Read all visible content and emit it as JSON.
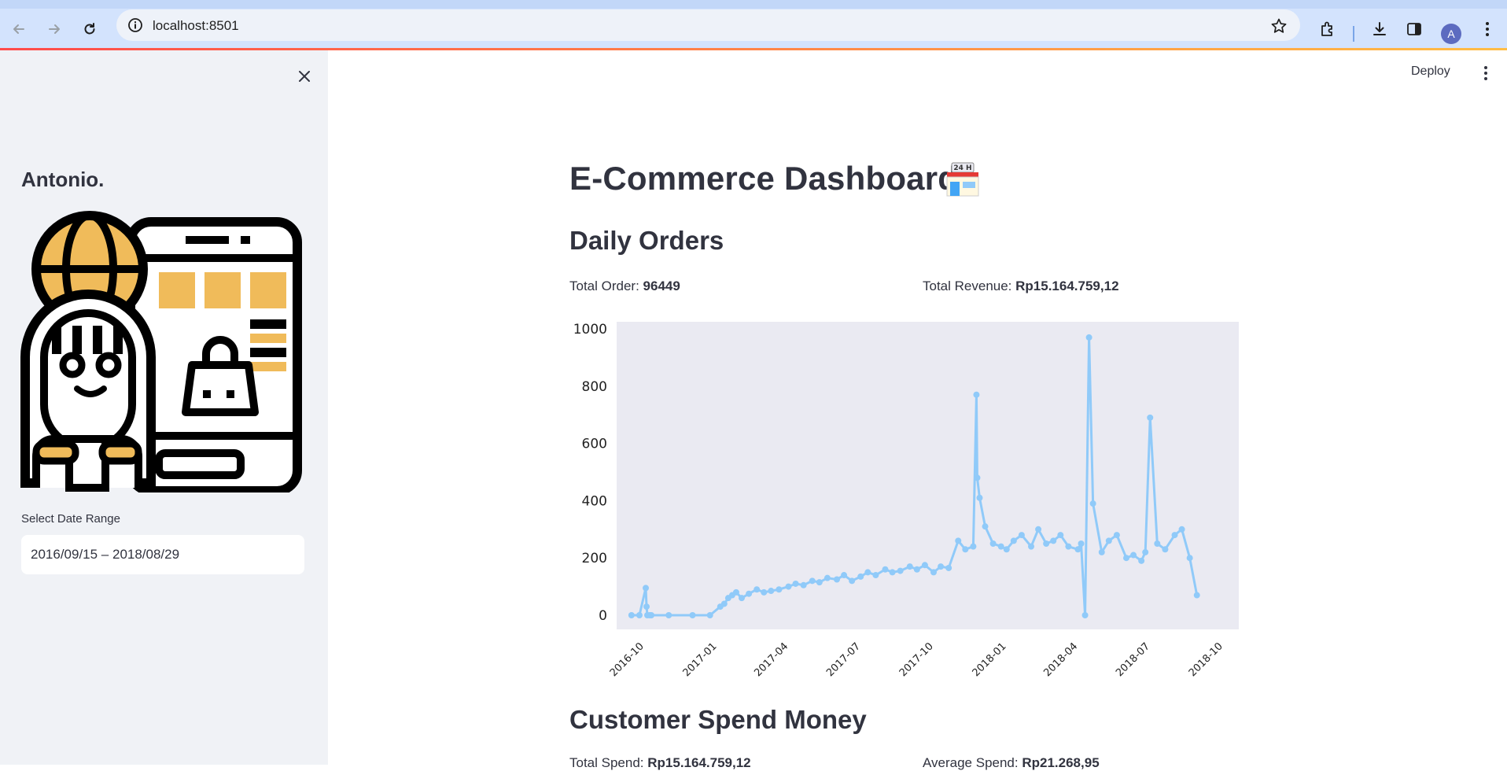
{
  "browser": {
    "url": "localhost:8501",
    "avatar_letter": "A"
  },
  "app": {
    "deploy_label": "Deploy"
  },
  "sidebar": {
    "brand": "Antonio.",
    "date_label": "Select Date Range",
    "date_value": "2016/09/15 – 2018/08/29"
  },
  "main": {
    "title": "E-Commerce Dashboard",
    "daily_orders_heading": "Daily Orders",
    "total_order_label": "Total Order:",
    "total_order_value": "96449",
    "total_revenue_label": "Total Revenue:",
    "total_revenue_value": "Rp15.164.759,12",
    "customer_spend_heading": "Customer Spend Money",
    "total_spend_label": "Total Spend:",
    "total_spend_value": "Rp15.164.759,12",
    "average_spend_label": "Average Spend:",
    "average_spend_value": "Rp21.268,95"
  },
  "colors": {
    "line": "#90caf9",
    "plot_bg": "#eaeaf2",
    "sidebar_bg": "#f0f2f6",
    "accent_yellow": "#f0bb5a"
  },
  "chart_data": {
    "type": "line",
    "title": "",
    "xlabel": "",
    "ylabel": "",
    "ylim": [
      0,
      1000
    ],
    "yticks": [
      0,
      200,
      400,
      600,
      800,
      1000
    ],
    "xticks": [
      "2016-10",
      "2017-01",
      "2017-04",
      "2017-07",
      "2017-10",
      "2018-01",
      "2018-04",
      "2018-07",
      "2018-10"
    ],
    "x": [
      "2016-09-15",
      "2016-09-25",
      "2016-10-03",
      "2016-10-04",
      "2016-10-05",
      "2016-10-08",
      "2016-10-10",
      "2016-11-01",
      "2016-12-01",
      "2016-12-23",
      "2017-01-05",
      "2017-01-10",
      "2017-01-15",
      "2017-01-20",
      "2017-01-25",
      "2017-02-01",
      "2017-02-10",
      "2017-02-20",
      "2017-03-01",
      "2017-03-10",
      "2017-03-20",
      "2017-04-01",
      "2017-04-10",
      "2017-04-20",
      "2017-05-01",
      "2017-05-10",
      "2017-05-20",
      "2017-06-01",
      "2017-06-10",
      "2017-06-20",
      "2017-07-01",
      "2017-07-10",
      "2017-07-20",
      "2017-08-01",
      "2017-08-10",
      "2017-08-20",
      "2017-09-01",
      "2017-09-10",
      "2017-09-20",
      "2017-10-01",
      "2017-10-10",
      "2017-10-20",
      "2017-11-01",
      "2017-11-10",
      "2017-11-20",
      "2017-11-24",
      "2017-11-25",
      "2017-11-28",
      "2017-12-05",
      "2017-12-15",
      "2017-12-25",
      "2018-01-01",
      "2018-01-10",
      "2018-01-20",
      "2018-02-01",
      "2018-02-10",
      "2018-02-20",
      "2018-03-01",
      "2018-03-10",
      "2018-03-20",
      "2018-04-01",
      "2018-04-05",
      "2018-04-10",
      "2018-04-15",
      "2018-04-20",
      "2018-05-01",
      "2018-05-10",
      "2018-05-20",
      "2018-06-01",
      "2018-06-10",
      "2018-06-20",
      "2018-06-25",
      "2018-07-01",
      "2018-07-10",
      "2018-07-20",
      "2018-08-01",
      "2018-08-10",
      "2018-08-20",
      "2018-08-29"
    ],
    "series": [
      {
        "values": [
          0,
          0,
          95,
          30,
          0,
          0,
          0,
          0,
          0,
          0,
          30,
          40,
          60,
          70,
          80,
          60,
          75,
          90,
          80,
          85,
          90,
          100,
          110,
          105,
          120,
          115,
          130,
          125,
          140,
          120,
          135,
          150,
          140,
          160,
          150,
          155,
          170,
          160,
          175,
          150,
          170,
          165,
          260,
          230,
          240,
          770,
          480,
          410,
          310,
          250,
          240,
          230,
          260,
          280,
          240,
          300,
          250,
          260,
          280,
          240,
          230,
          250,
          0,
          970,
          390,
          220,
          260,
          280,
          200,
          210,
          190,
          220,
          690,
          250,
          230,
          280,
          300,
          200,
          70
        ]
      }
    ]
  }
}
